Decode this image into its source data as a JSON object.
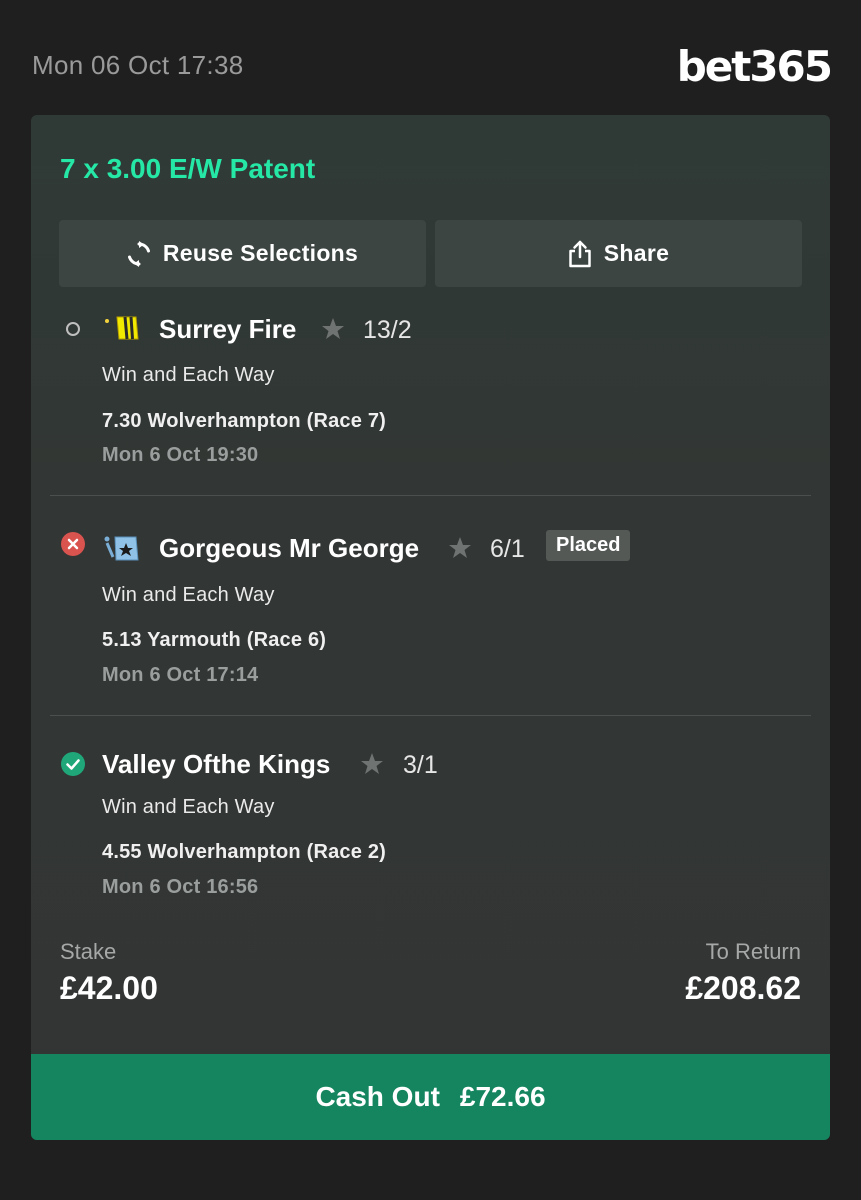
{
  "header": {
    "timestamp": "Mon 06 Oct 17:38",
    "logo": "bet365"
  },
  "bet": {
    "title": "7 x 3.00 E/W Patent",
    "actions": {
      "reuse_label": "Reuse Selections",
      "share_label": "Share"
    },
    "selections": [
      {
        "status": "pending",
        "name": "Surrey Fire",
        "odds": "13/2",
        "market": "Win and Each Way",
        "race": "7.30 Wolverhampton (Race 7)",
        "time": "Mon 6 Oct 19:30"
      },
      {
        "status": "lost",
        "name": "Gorgeous Mr George",
        "odds": "6/1",
        "badge": "Placed",
        "market": "Win and Each Way",
        "race": "5.13 Yarmouth (Race 6)",
        "time": "Mon 6 Oct 17:14"
      },
      {
        "status": "won",
        "name": "Valley Ofthe Kings",
        "odds": "3/1",
        "market": "Win and Each Way",
        "race": "4.55 Wolverhampton (Race 2)",
        "time": "Mon 6 Oct 16:56"
      }
    ],
    "stake_label": "Stake",
    "stake_value": "£42.00",
    "return_label": "To Return",
    "return_value": "£208.62",
    "cashout_label": "Cash Out",
    "cashout_value": "£72.66"
  },
  "colors": {
    "accent_green": "#26e8a6",
    "cashout_bg": "#158560",
    "won": "#1fa77a",
    "lost": "#d9534f"
  },
  "icons": [
    "refresh-icon",
    "share-icon",
    "star-icon",
    "pending-circle-icon",
    "cross-circle-icon",
    "check-circle-icon",
    "jockey-silk-icon"
  ]
}
